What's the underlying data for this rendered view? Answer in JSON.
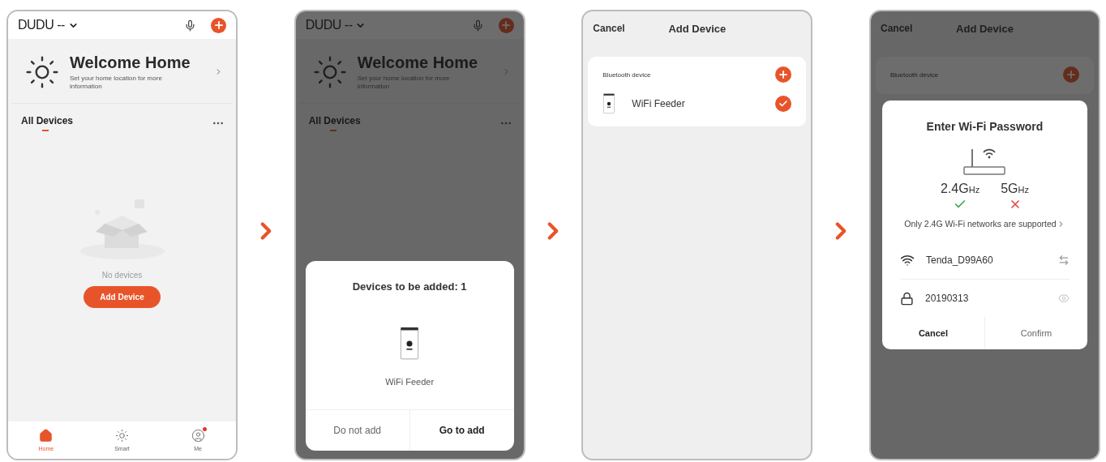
{
  "screens": [
    {
      "kind": "home",
      "dimmed": false,
      "header": {
        "home_name": "DUDU --"
      },
      "welcome": {
        "title": "Welcome Home",
        "subtitle": "Set your home location for more information"
      },
      "section_title": "All Devices",
      "empty_state": {
        "text": "No devices",
        "button": "Add Device"
      },
      "tabs": [
        {
          "kind": "home",
          "label": "Home",
          "selected": true,
          "badge": false
        },
        {
          "kind": "smart",
          "label": "Smart",
          "selected": false,
          "badge": false
        },
        {
          "kind": "me",
          "label": "Me",
          "selected": false,
          "badge": true
        }
      ]
    },
    {
      "kind": "home",
      "dimmed": true,
      "header": {
        "home_name": "DUDU --"
      },
      "welcome": {
        "title": "Welcome Home",
        "subtitle": "Set your home location for more information"
      },
      "section_title": "All Devices",
      "dialog": {
        "kind": "devices_to_add",
        "title": "Devices to be added: 1",
        "device": "WiFi Feeder",
        "buttons": [
          {
            "label": "Do not add",
            "emphasized": false
          },
          {
            "label": "Go to add",
            "emphasized": true
          }
        ]
      }
    },
    {
      "kind": "add_device",
      "dimmed": false,
      "cancel": "Cancel",
      "title": "Add Device",
      "card": {
        "heading": "Bluetooth device",
        "devices": [
          {
            "name": "WiFi Feeder",
            "selected": true
          }
        ]
      }
    },
    {
      "kind": "add_device",
      "dimmed": true,
      "cancel": "Cancel",
      "title": "Add Device",
      "card": {
        "heading": "Bluetooth device"
      },
      "dialog": {
        "kind": "wifi_password",
        "title": "Enter Wi-Fi Password",
        "bands": [
          {
            "value": "2.4G",
            "unit": "Hz",
            "supported": true
          },
          {
            "value": "5G",
            "unit": "Hz",
            "supported": false
          }
        ],
        "note": "Only 2.4G Wi-Fi networks are supported",
        "network": "Tenda_D99A60",
        "password": "20190313",
        "buttons": [
          {
            "label": "Cancel",
            "emphasized": true
          },
          {
            "label": "Confirm",
            "emphasized": false
          }
        ]
      }
    }
  ]
}
